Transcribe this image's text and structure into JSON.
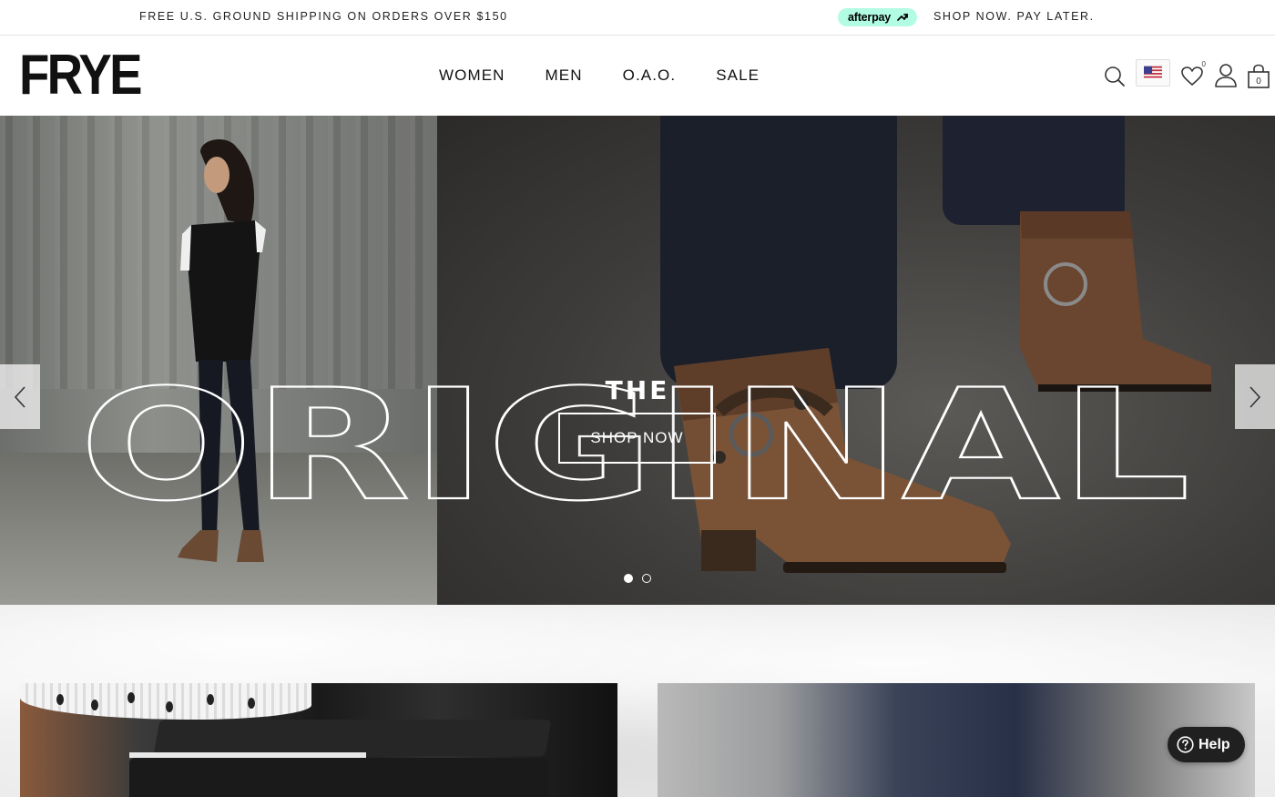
{
  "announcement": {
    "left_text": "FREE U.S. GROUND SHIPPING ON ORDERS OVER $150",
    "afterpay_label": "afterpay",
    "right_text": "SHOP NOW. PAY LATER."
  },
  "header": {
    "logo": "FRYE",
    "nav": [
      "WOMEN",
      "MEN",
      "O.A.O.",
      "SALE"
    ],
    "icons": [
      "search-icon",
      "us-flag-icon",
      "heart-icon",
      "user-icon",
      "bag-icon"
    ],
    "wishlist_count": "0",
    "bag_count": "0"
  },
  "hero": {
    "title_small": "THE",
    "title_large": "ORIGINAL",
    "cta_label": "SHOP NOW",
    "slide_count": 2,
    "active_slide": 1
  },
  "help_widget": {
    "label": "Help"
  },
  "colors": {
    "afterpay_mint": "#b2fce4",
    "text_dark": "#111111",
    "help_bg": "#202020"
  }
}
